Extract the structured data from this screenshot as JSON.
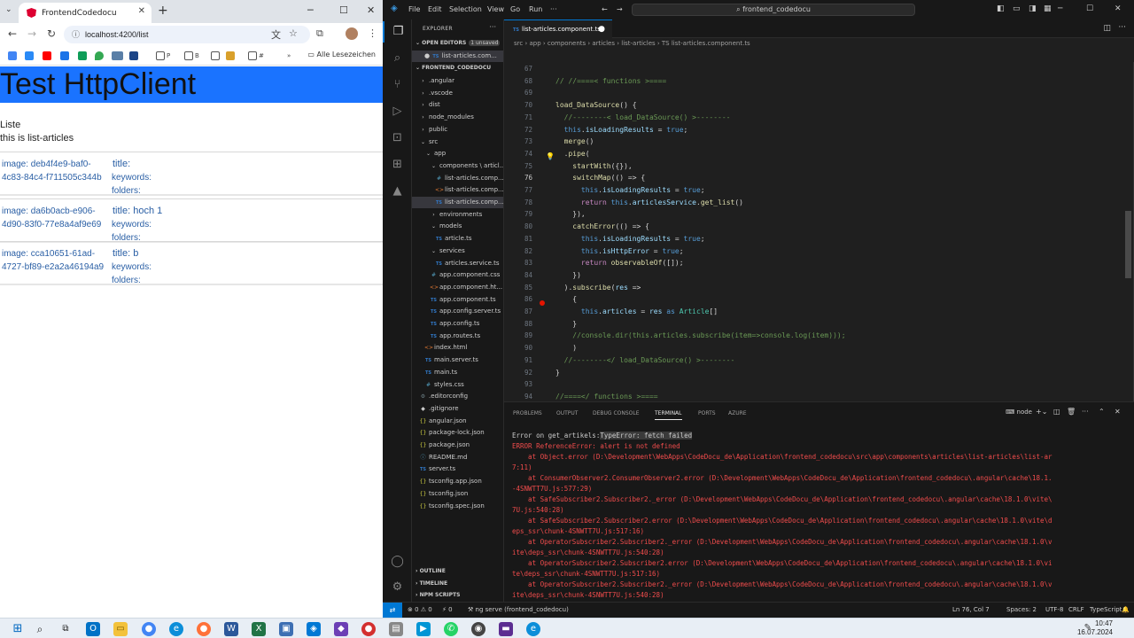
{
  "browser": {
    "tab_title": "FrontendCodedocu",
    "url": "localhost:4200/list",
    "bookmarks": [
      "P",
      "B",
      "#"
    ],
    "all_bookmarks_label": "Alle Lesezeichen"
  },
  "page": {
    "header": "Test HttpClient",
    "list_title": "Liste",
    "list_subtitle": "this is list-articles",
    "cards": [
      {
        "image": "image: deb4f4e9-baf0-4c83-84c4-f711505c344b",
        "title": "title:",
        "keywords": "keywords:",
        "folders": "folders:"
      },
      {
        "image": "image: da6b0acb-e906-4d90-83f0-77e8a4af9e69",
        "title": "title: hoch 1",
        "keywords": "keywords:",
        "folders": "folders:"
      },
      {
        "image": "image: cca10651-61ad-4727-bf89-e2a2a46194a9",
        "title": "title: b",
        "keywords": "keywords:",
        "folders": "folders:"
      }
    ]
  },
  "vscode": {
    "menu": [
      "File",
      "Edit",
      "Selection",
      "View",
      "Go",
      "Run"
    ],
    "search": "frontend_codedocu",
    "explorer_label": "EXPLORER",
    "open_editors_label": "OPEN EDITORS",
    "unsaved_badge": "1 unsaved",
    "open_editor_file": "list-articles.com...",
    "project_label": "FRONTEND_CODEDOCU",
    "tree": [
      {
        "label": ".angular",
        "icon": "chevron-right",
        "indent": 1
      },
      {
        "label": ".vscode",
        "icon": "chevron-right",
        "indent": 1
      },
      {
        "label": "dist",
        "icon": "chevron-right",
        "indent": 1
      },
      {
        "label": "node_modules",
        "icon": "chevron-right",
        "indent": 1
      },
      {
        "label": "public",
        "icon": "chevron-right",
        "indent": 1
      },
      {
        "label": "src",
        "icon": "chevron-down",
        "indent": 1
      },
      {
        "label": "app",
        "icon": "chevron-down",
        "indent": 2
      },
      {
        "label": "components \\ articl...",
        "icon": "chevron-down",
        "indent": 3
      },
      {
        "label": "list-articles.comp...",
        "icon": "css",
        "indent": 4
      },
      {
        "label": "list-articles.comp...",
        "icon": "html",
        "indent": 4
      },
      {
        "label": "list-articles.comp...",
        "icon": "ts",
        "indent": 4
      },
      {
        "label": "environments",
        "icon": "chevron-right",
        "indent": 3
      },
      {
        "label": "models",
        "icon": "chevron-down",
        "indent": 3
      },
      {
        "label": "article.ts",
        "icon": "ts",
        "indent": 4
      },
      {
        "label": "services",
        "icon": "chevron-down",
        "indent": 3
      },
      {
        "label": "articles.service.ts",
        "icon": "ts",
        "indent": 4
      },
      {
        "label": "app.component.css",
        "icon": "css",
        "indent": 3
      },
      {
        "label": "app.component.ht...",
        "icon": "html",
        "indent": 3
      },
      {
        "label": "app.component.ts",
        "icon": "ts",
        "indent": 3
      },
      {
        "label": "app.config.server.ts",
        "icon": "ts",
        "indent": 3
      },
      {
        "label": "app.config.ts",
        "icon": "ts",
        "indent": 3
      },
      {
        "label": "app.routes.ts",
        "icon": "ts",
        "indent": 3
      },
      {
        "label": "index.html",
        "icon": "html",
        "indent": 2
      },
      {
        "label": "main.server.ts",
        "icon": "ts",
        "indent": 2
      },
      {
        "label": "main.ts",
        "icon": "ts",
        "indent": 2
      },
      {
        "label": "styles.css",
        "icon": "css",
        "indent": 2
      },
      {
        "label": ".editorconfig",
        "icon": "gear",
        "indent": 1
      },
      {
        "label": ".gitignore",
        "icon": "dot",
        "indent": 1
      },
      {
        "label": "angular.json",
        "icon": "json",
        "indent": 1
      },
      {
        "label": "package-lock.json",
        "icon": "json",
        "indent": 1
      },
      {
        "label": "package.json",
        "icon": "json",
        "indent": 1
      },
      {
        "label": "README.md",
        "icon": "md",
        "indent": 1
      },
      {
        "label": "server.ts",
        "icon": "ts",
        "indent": 1
      },
      {
        "label": "tsconfig.app.json",
        "icon": "json",
        "indent": 1
      },
      {
        "label": "tsconfig.json",
        "icon": "json",
        "indent": 1
      },
      {
        "label": "tsconfig.spec.json",
        "icon": "json",
        "indent": 1
      }
    ],
    "sidebar_bottom": [
      "OUTLINE",
      "TIMELINE",
      "NPM SCRIPTS"
    ],
    "editor_tab": "list-articles.component.ts",
    "breadcrumb": "src › app › components › articles › list-articles › TS list-articles.component.ts",
    "code_lines": [
      {
        "n": "67",
        "text": ""
      },
      {
        "n": "68",
        "text": "// //====< functions >===="
      },
      {
        "n": "69",
        "text": ""
      },
      {
        "n": "70",
        "text": "load_DataSource() {"
      },
      {
        "n": "71",
        "text": "  //--------< load_DataSource() >--------"
      },
      {
        "n": "72",
        "text": "  this.isLoadingResults = true;"
      },
      {
        "n": "73",
        "text": "  merge()"
      },
      {
        "n": "74",
        "text": "  .pipe("
      },
      {
        "n": "75",
        "text": "    startWith({}),"
      },
      {
        "n": "76",
        "text": "    switchMap(() => {"
      },
      {
        "n": "77",
        "text": "      this.isLoadingResults = true;"
      },
      {
        "n": "78",
        "text": "      return this.articlesService.get_list()"
      },
      {
        "n": "79",
        "text": "    }),"
      },
      {
        "n": "80",
        "text": "    catchError(() => {"
      },
      {
        "n": "81",
        "text": "      this.isLoadingResults = true;"
      },
      {
        "n": "82",
        "text": "      this.isHttpError = true;"
      },
      {
        "n": "83",
        "text": "      return observableOf([]);"
      },
      {
        "n": "84",
        "text": "    })"
      },
      {
        "n": "85",
        "text": "  ).subscribe(res =>"
      },
      {
        "n": "86",
        "text": "    {"
      },
      {
        "n": "87",
        "text": "      this.articles = res as Article[]"
      },
      {
        "n": "88",
        "text": "    }"
      },
      {
        "n": "89",
        "text": "    //console.dir(this.articles.subscribe(item=>console.log(item)));"
      },
      {
        "n": "90",
        "text": "    )"
      },
      {
        "n": "91",
        "text": "  //--------</ load_DataSource() >--------"
      },
      {
        "n": "92",
        "text": "}"
      },
      {
        "n": "93",
        "text": ""
      },
      {
        "n": "94",
        "text": "//====</ functions >===="
      }
    ],
    "panel_tabs": [
      "PROBLEMS",
      "OUTPUT",
      "DEBUG CONSOLE",
      "TERMINAL",
      "PORTS",
      "AZURE"
    ],
    "terminal_name": "node",
    "terminal": {
      "first_prefix": "Error on get_artikels:",
      "first_highlight": "TypeError: fetch failed",
      "lines": [
        "ERROR ReferenceError: alert is not defined",
        "    at Object.error (D:\\Development\\WebApps\\CodeDocu_de\\Application\\frontend_codedocu\\src\\app\\components\\articles\\list-articles\\list-ar",
        "7:11)",
        "    at ConsumerObserver2.ConsumerObserver2.error (D:\\Development\\WebApps\\CodeDocu_de\\Application\\frontend_codedocu\\.angular\\cache\\18.1.",
        "-4SNWTT7U.js:577:29)",
        "    at SafeSubscriber2.Subscriber2._error (D:\\Development\\WebApps\\CodeDocu_de\\Application\\frontend_codedocu\\.angular\\cache\\18.1.0\\vite\\",
        "7U.js:540:28)",
        "    at SafeSubscriber2.Subscriber2.error (D:\\Development\\WebApps\\CodeDocu_de\\Application\\frontend_codedocu\\.angular\\cache\\18.1.0\\vite\\d",
        "eps_ssr\\chunk-4SNWTT7U.js:517:16)",
        "    at OperatorSubscriber2.Subscriber2._error (D:\\Development\\WebApps\\CodeDocu_de\\Application\\frontend_codedocu\\.angular\\cache\\18.1.0\\v",
        "ite\\deps_ssr\\chunk-4SNWTT7U.js:540:28)",
        "    at OperatorSubscriber2.Subscriber2.error (D:\\Development\\WebApps\\CodeDocu_de\\Application\\frontend_codedocu\\.angular\\cache\\18.1.0\\vi",
        "te\\deps_ssr\\chunk-4SNWTT7U.js:517:16)",
        "    at OperatorSubscriber2.Subscriber2._error (D:\\Development\\WebApps\\CodeDocu_de\\Application\\frontend_codedocu\\.angular\\cache\\18.1.0\\v",
        "ite\\deps_ssr\\chunk-4SNWTT7U.js:540:28)"
      ]
    },
    "status": {
      "problems": "⊗ 0 ⚠ 0",
      "ports": "⚡ 0",
      "task": "ng serve (frontend_codedocu)",
      "position": "Ln 76, Col 7",
      "spaces": "Spaces: 2",
      "encoding": "UTF-8",
      "eol": "CRLF",
      "language": "TypeScript"
    }
  },
  "taskbar": {
    "time": "10:47",
    "date": "16.07.2024"
  },
  "colors": {
    "header_blue": "#1a73ff",
    "link_blue": "#2a5fa5",
    "vs_accent": "#0078d4",
    "error_red": "#f14c4c"
  }
}
